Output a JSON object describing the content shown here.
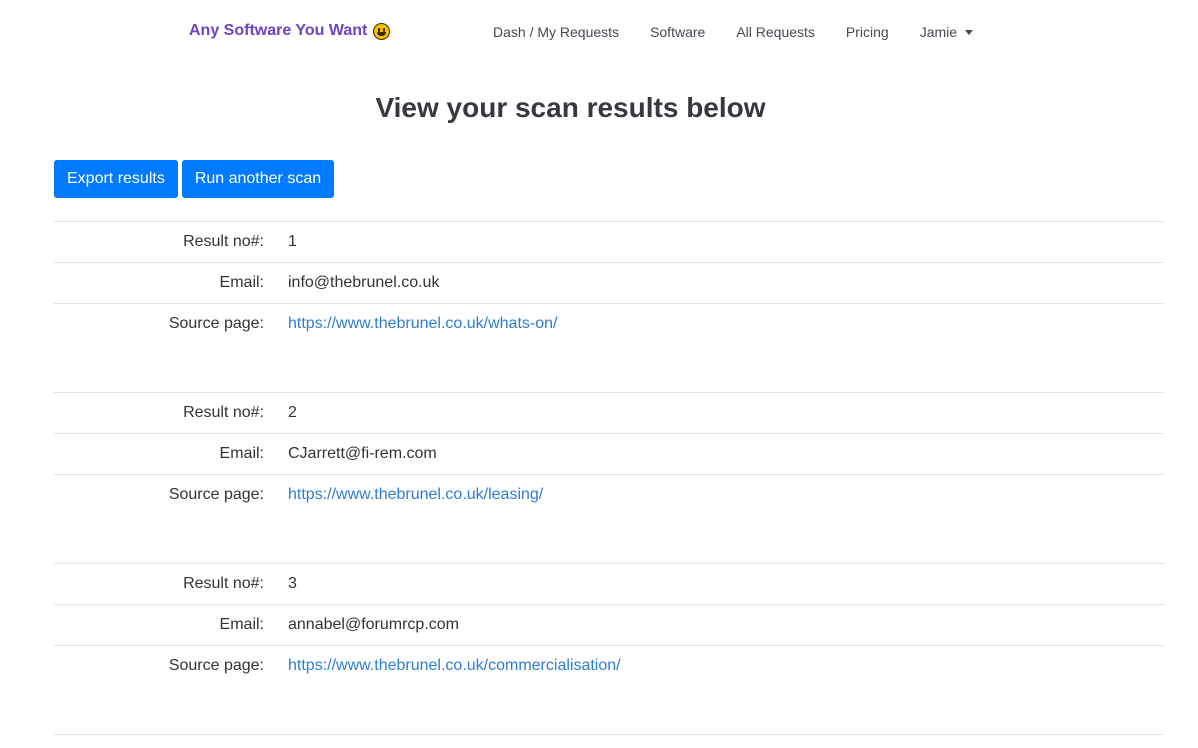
{
  "navbar": {
    "brand": "Any Software You Want",
    "brand_icon": "grinning-face-icon",
    "items": [
      {
        "label": "Dash / My Requests"
      },
      {
        "label": "Software"
      },
      {
        "label": "All Requests"
      },
      {
        "label": "Pricing"
      }
    ],
    "user": {
      "label": "Jamie"
    }
  },
  "page": {
    "title": "View your scan results below"
  },
  "actions": {
    "export_label": "Export results",
    "run_label": "Run another scan"
  },
  "labels": {
    "result_no": "Result no#:",
    "email": "Email:",
    "source_page": "Source page:"
  },
  "results": [
    {
      "no": "1",
      "email": "info@thebrunel.co.uk",
      "source": "https://www.thebrunel.co.uk/whats-on/"
    },
    {
      "no": "2",
      "email": "CJarrett@fi-rem.com",
      "source": "https://www.thebrunel.co.uk/leasing/"
    },
    {
      "no": "3",
      "email": "annabel@forumrcp.com",
      "source": "https://www.thebrunel.co.uk/commercialisation/"
    }
  ],
  "colors": {
    "brand": "#6f42c1",
    "primary_button": "#007bff",
    "link": "#2f7dd1"
  }
}
